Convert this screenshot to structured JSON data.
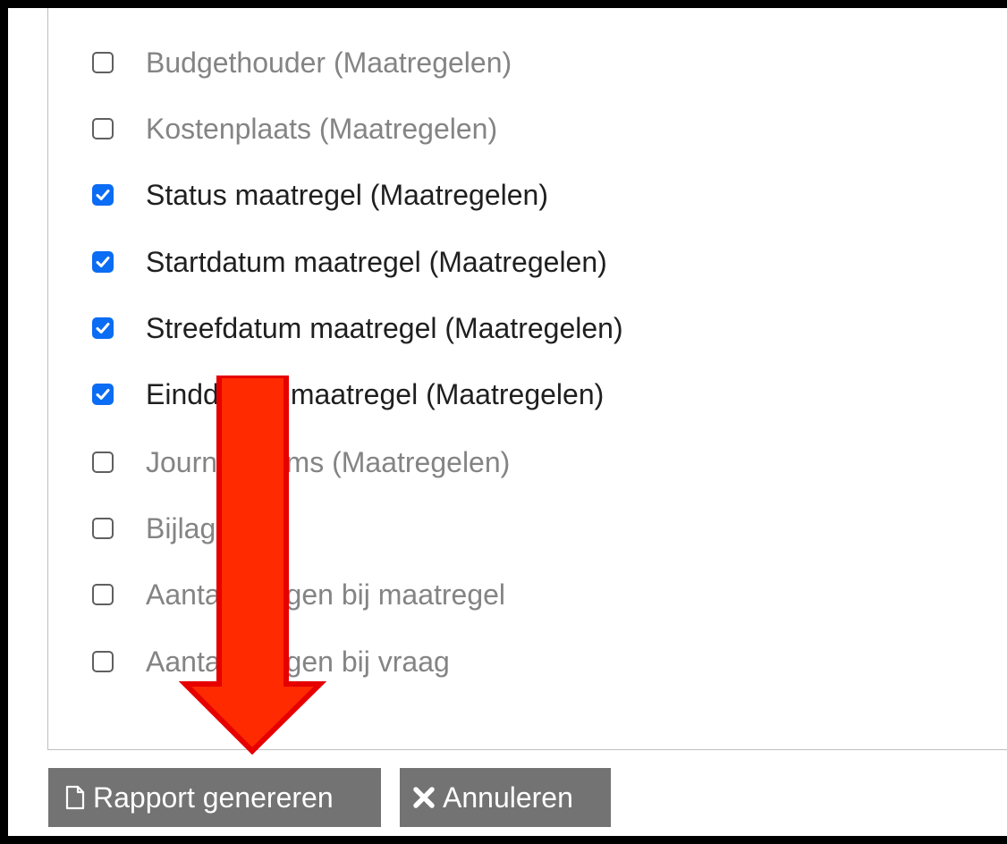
{
  "options": [
    {
      "label": "Budgethouder (Maatregelen)",
      "checked": false
    },
    {
      "label": "Kostenplaats (Maatregelen)",
      "checked": false
    },
    {
      "label": "Status maatregel (Maatregelen)",
      "checked": true
    },
    {
      "label": "Startdatum maatregel (Maatregelen)",
      "checked": true
    },
    {
      "label": "Streefdatum maatregel (Maatregelen)",
      "checked": true
    },
    {
      "label": "Einddatum maatregel (Maatregelen)",
      "checked": true
    },
    {
      "label": "Journaalitems (Maatregelen)",
      "checked": false
    },
    {
      "label": "Bijlagen",
      "checked": false
    },
    {
      "label": "Aantal bijlagen bij maatregel",
      "checked": false
    },
    {
      "label": "Aantal bijlagen bij vraag",
      "checked": false
    }
  ],
  "buttons": {
    "generate": {
      "label": "Rapport genereren",
      "icon": "document-icon"
    },
    "cancel": {
      "label": "Annuleren",
      "icon": "close-x-icon"
    }
  },
  "annotation": {
    "icon": "down-arrow-icon",
    "color": "#ff2a00",
    "outline": "#e60000"
  },
  "colors": {
    "checkbox_checked": "#0b6cf4",
    "button_bg": "#737373"
  }
}
